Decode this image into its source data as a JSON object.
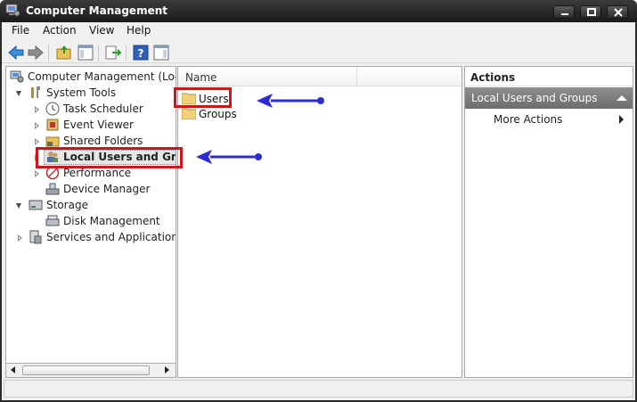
{
  "window": {
    "title": "Computer Management"
  },
  "menu": {
    "items": [
      "File",
      "Action",
      "View",
      "Help"
    ]
  },
  "tree": {
    "root": "Computer Management (Local",
    "system_tools": "System Tools",
    "task_scheduler": "Task Scheduler",
    "event_viewer": "Event Viewer",
    "shared_folders": "Shared Folders",
    "local_users": "Local Users and Group",
    "performance": "Performance",
    "device_manager": "Device Manager",
    "storage": "Storage",
    "disk_management": "Disk Management",
    "services": "Services and Applications"
  },
  "list": {
    "column_name": "Name",
    "items": [
      "Users",
      "Groups"
    ]
  },
  "actions": {
    "title": "Actions",
    "section": "Local Users and Groups",
    "more": "More Actions"
  },
  "colors": {
    "highlight": "#d0141a",
    "annotation_arrow": "#2b2bd8"
  }
}
